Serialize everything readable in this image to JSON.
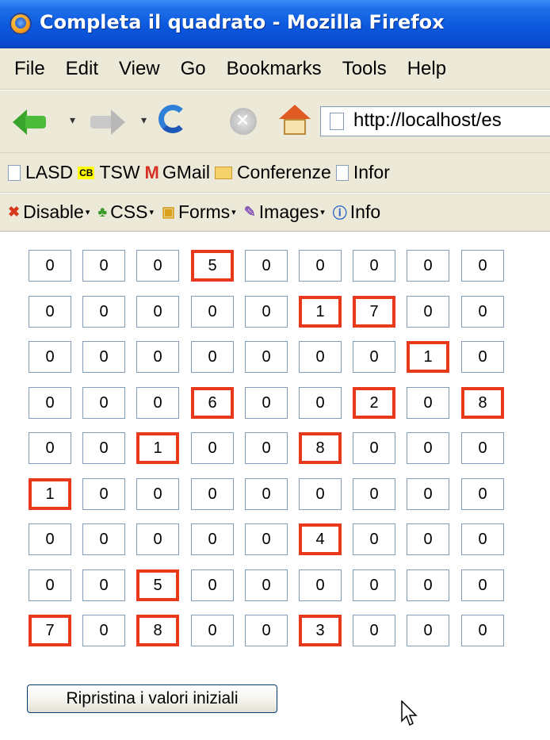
{
  "window": {
    "title": "Completa il quadrato - Mozilla Firefox"
  },
  "menu": [
    "File",
    "Edit",
    "View",
    "Go",
    "Bookmarks",
    "Tools",
    "Help"
  ],
  "toolbar": {
    "address": "http://localhost/es"
  },
  "bookmarks": [
    {
      "label": "LASD",
      "icon": "page-icon"
    },
    {
      "label": "TSW",
      "icon": "cb-icon",
      "badge": "CB"
    },
    {
      "label": "GMail",
      "icon": "gmail-icon",
      "badge": "M"
    },
    {
      "label": "Conferenze",
      "icon": "folder-icon"
    },
    {
      "label": "Infor",
      "icon": "page-icon"
    }
  ],
  "webdev": [
    {
      "label": "Disable",
      "icon": "disable-icon",
      "glyph": "✖"
    },
    {
      "label": "CSS",
      "icon": "css-icon",
      "glyph": "♣"
    },
    {
      "label": "Forms",
      "icon": "forms-icon",
      "glyph": "▣"
    },
    {
      "label": "Images",
      "icon": "images-icon",
      "glyph": "✎"
    },
    {
      "label": "Info",
      "icon": "info-icon",
      "glyph": "ⓘ"
    }
  ],
  "grid": [
    [
      "0",
      "0",
      "0",
      "5",
      "0",
      "0",
      "0",
      "0",
      "0"
    ],
    [
      "0",
      "0",
      "0",
      "0",
      "0",
      "1",
      "7",
      "0",
      "0"
    ],
    [
      "0",
      "0",
      "0",
      "0",
      "0",
      "0",
      "0",
      "1",
      "0"
    ],
    [
      "0",
      "0",
      "0",
      "6",
      "0",
      "0",
      "2",
      "0",
      "8"
    ],
    [
      "0",
      "0",
      "1",
      "0",
      "0",
      "8",
      "0",
      "0",
      "0"
    ],
    [
      "1",
      "0",
      "0",
      "0",
      "0",
      "0",
      "0",
      "0",
      "0"
    ],
    [
      "0",
      "0",
      "0",
      "0",
      "0",
      "4",
      "0",
      "0",
      "0"
    ],
    [
      "0",
      "0",
      "5",
      "0",
      "0",
      "0",
      "0",
      "0",
      "0"
    ],
    [
      "7",
      "0",
      "8",
      "0",
      "0",
      "3",
      "0",
      "0",
      "0"
    ]
  ],
  "fixed_cells": [
    [
      0,
      3
    ],
    [
      1,
      5
    ],
    [
      1,
      6
    ],
    [
      2,
      7
    ],
    [
      3,
      3
    ],
    [
      3,
      6
    ],
    [
      3,
      8
    ],
    [
      4,
      2
    ],
    [
      4,
      5
    ],
    [
      5,
      0
    ],
    [
      6,
      5
    ],
    [
      7,
      2
    ],
    [
      8,
      0
    ],
    [
      8,
      2
    ],
    [
      8,
      5
    ]
  ],
  "colors": {
    "fixed_border": "#e8391a",
    "input_border": "#7f9db9",
    "titlebar": "#0b58de"
  },
  "reset_button": {
    "label": "Ripristina i valori iniziali"
  }
}
